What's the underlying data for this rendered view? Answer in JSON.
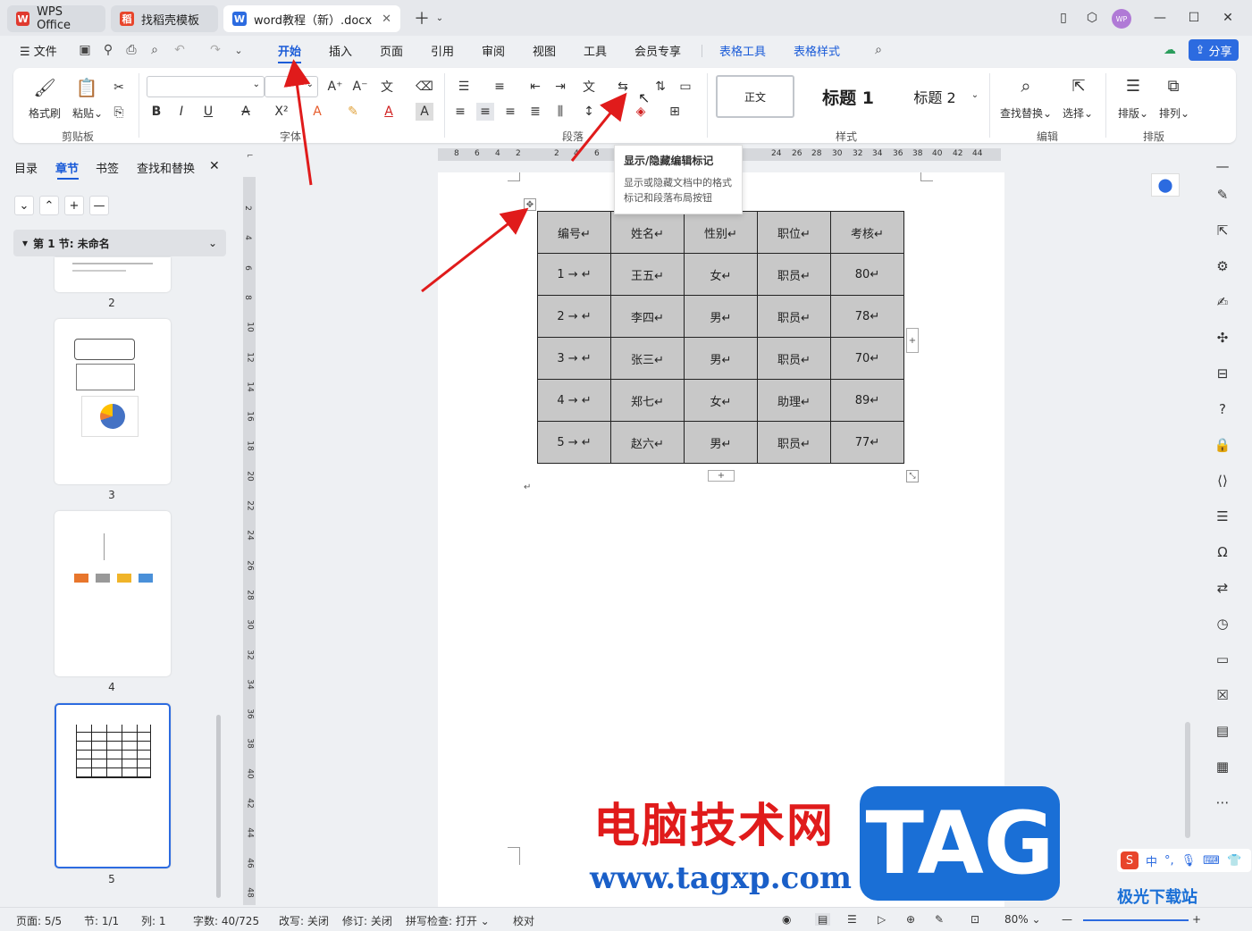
{
  "titlebar": {
    "tabs": [
      {
        "label": "WPS Office"
      },
      {
        "label": "找稻壳模板"
      },
      {
        "label": "word教程（新）.docx"
      }
    ],
    "avatar": "WP"
  },
  "menubar": {
    "file": "文件",
    "items": [
      "开始",
      "插入",
      "页面",
      "引用",
      "审阅",
      "视图",
      "工具",
      "会员专享"
    ],
    "context_items": [
      "表格工具",
      "表格样式"
    ],
    "share": "分享"
  },
  "ribbon": {
    "clipboard": {
      "format_painter": "格式刷",
      "paste": "粘贴",
      "label": "剪贴板"
    },
    "font": {
      "label": "字体"
    },
    "paragraph": {
      "label": "段落"
    },
    "styles": {
      "normal": "正文",
      "h1": "标题  1",
      "h2": "标题  2",
      "label": "样式"
    },
    "edit": {
      "find_replace": "查找替换",
      "select": "选择",
      "label": "编辑"
    },
    "layout": {
      "arrange": "排版",
      "order": "排列",
      "label": "排版"
    }
  },
  "leftpanel": {
    "tabs": [
      "目录",
      "章节",
      "书签",
      "查找和替换"
    ],
    "section_title": "第 1 节: 未命名",
    "pages": [
      "2",
      "3",
      "4",
      "5"
    ]
  },
  "tooltip": {
    "title": "显示/隐藏编辑标记",
    "desc": "显示或隐藏文档中的格式标记和段落布局按钮"
  },
  "table": {
    "headers": [
      "编号",
      "姓名",
      "性别",
      "职位",
      "考核"
    ],
    "rows": [
      [
        "1",
        "王五",
        "女",
        "职员",
        "80"
      ],
      [
        "2",
        "李四",
        "男",
        "职员",
        "78"
      ],
      [
        "3",
        "张三",
        "男",
        "职员",
        "70"
      ],
      [
        "4",
        "郑七",
        "女",
        "助理",
        "89"
      ],
      [
        "5",
        "赵六",
        "男",
        "职员",
        "77"
      ]
    ]
  },
  "hruler": [
    "8",
    "6",
    "4",
    "2",
    "2",
    "4",
    "6",
    "24",
    "26",
    "28",
    "30",
    "32",
    "34",
    "36",
    "38",
    "40",
    "42",
    "44"
  ],
  "vruler": [
    "2",
    "4",
    "6",
    "8",
    "10",
    "12",
    "14",
    "16",
    "18",
    "20",
    "22",
    "24",
    "26",
    "28",
    "30",
    "32",
    "34",
    "36",
    "38",
    "40",
    "42",
    "44",
    "46",
    "48"
  ],
  "statusbar": {
    "page": "页面: 5/5",
    "section": "节: 1/1",
    "column": "列: 1",
    "words": "字数: 40/725",
    "revise_mode": "改写: 关闭",
    "track": "修订: 关闭",
    "spell": "拼写检查: 打开",
    "proof": "校对",
    "zoom": "80%"
  },
  "watermark": {
    "cn": "电脑技术网",
    "url": "www.tagxp.com",
    "tag": "TAG",
    "jg": "极光下载站"
  },
  "ime": {
    "label": "中"
  }
}
